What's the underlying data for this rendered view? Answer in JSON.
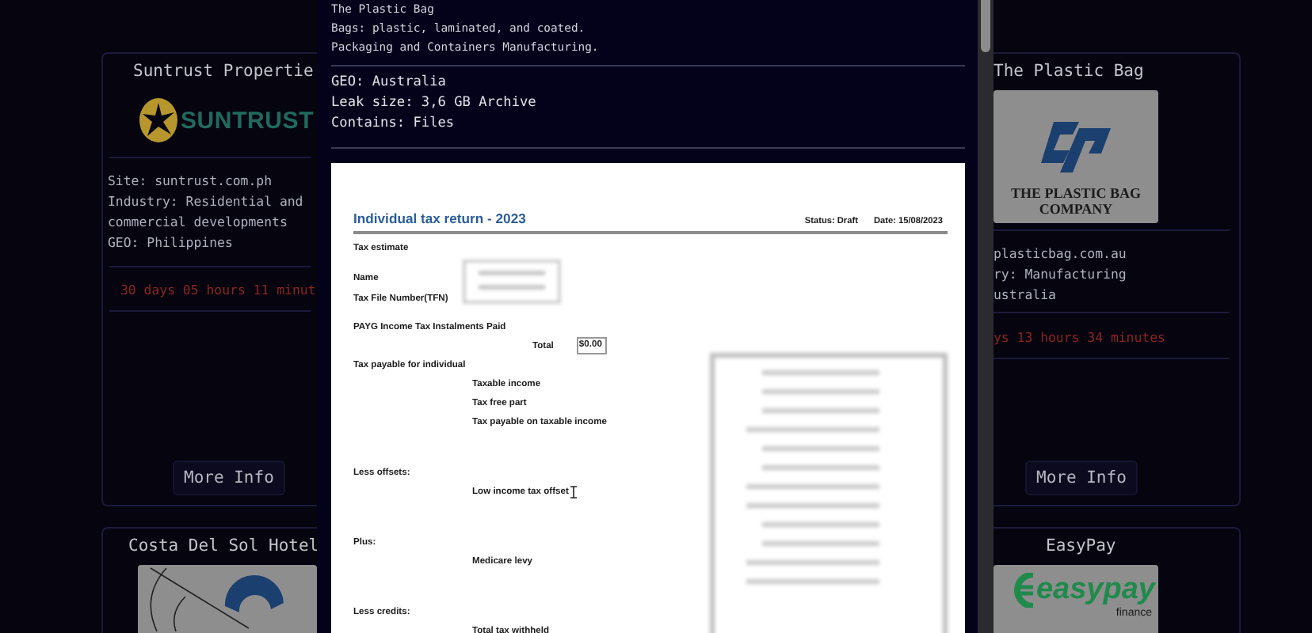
{
  "listings_left": [
    {
      "title": "Suntrust Propertie",
      "logo": {
        "kind": "sunburst",
        "lines": [
          "SUNTRUST"
        ]
      },
      "details": [
        "Site: suntrust.com.ph",
        "Industry: Residential and",
        "commercial developments",
        "GEO: Philippines"
      ],
      "countdown": "30 days 05 hours 11 minut",
      "button": "More Info"
    },
    {
      "title": "Costa Del Sol Hotel",
      "logo": {
        "kind": "leaf"
      }
    }
  ],
  "modal": {
    "description": [
      "The Plastic Bag",
      "Bags: plastic, laminated, and coated.",
      "Packaging and Containers Manufacturing."
    ],
    "facts": [
      "GEO: Australia",
      "Leak size: 3,6 GB Archive",
      "Contains: Files"
    ],
    "document": {
      "title": "Individual tax return - 2023",
      "status": "Status: Draft",
      "date": "Date: 15/08/2023",
      "rows": [
        {
          "kind": "section",
          "text": "Tax estimate"
        },
        {
          "kind": "redacted",
          "labels": [
            "Name",
            "Tax File Number(TFN)"
          ]
        },
        {
          "kind": "section",
          "text": "PAYG Income Tax Instalments Paid"
        },
        {
          "kind": "total",
          "text": "Total",
          "value": "$0.00"
        },
        {
          "kind": "section",
          "text": "Tax payable for individual"
        },
        {
          "kind": "item",
          "text": "Taxable income"
        },
        {
          "kind": "item",
          "text": "Tax free part"
        },
        {
          "kind": "item",
          "text": "Tax payable on taxable income"
        },
        {
          "kind": "section",
          "text": "Less offsets:"
        },
        {
          "kind": "item",
          "text": "Low income tax offset",
          "pointer": true
        },
        {
          "kind": "section",
          "text": "Plus:"
        },
        {
          "kind": "item",
          "text": "Medicare levy"
        },
        {
          "kind": "section",
          "text": "Less credits:"
        },
        {
          "kind": "item",
          "text": "Total tax withheld"
        }
      ]
    }
  },
  "listings_right": [
    {
      "title": "The Plastic Bag",
      "logo": {
        "kind": "ribbon",
        "lines": [
          "THE PLASTIC BAG",
          "COMPANY"
        ]
      },
      "details": [
        "plasticbag.com.au",
        "ry: Manufacturing",
        "ustralia"
      ],
      "countdown": "ys 13 hours 34 minutes",
      "button": "More Info"
    },
    {
      "title": "EasyPay",
      "logo": {
        "kind": "wave",
        "lines": [
          "easypay",
          "finance"
        ]
      }
    }
  ]
}
